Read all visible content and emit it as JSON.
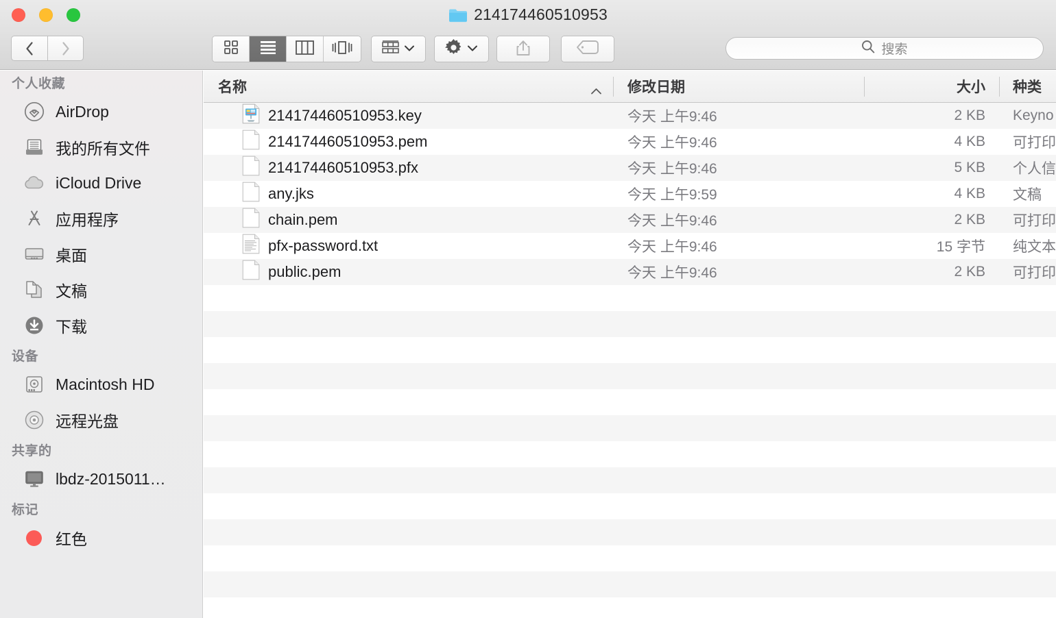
{
  "window": {
    "title": "214174460510953",
    "title_icon": "folder-icon",
    "traffic_lights": [
      {
        "name": "close",
        "color": "#ff5f52"
      },
      {
        "name": "minimize",
        "color": "#ffbd2e"
      },
      {
        "name": "zoom",
        "color": "#28c63f"
      }
    ]
  },
  "toolbar": {
    "back": {
      "icon": "chevron-left-icon",
      "enabled": true
    },
    "forward": {
      "icon": "chevron-right-icon",
      "enabled": false
    },
    "view_modes": [
      {
        "name": "icon-view",
        "icon": "grid-icon",
        "active": false
      },
      {
        "name": "list-view",
        "icon": "list-icon",
        "active": true
      },
      {
        "name": "column-view",
        "icon": "columns-icon",
        "active": false
      },
      {
        "name": "coverflow-view",
        "icon": "coverflow-icon",
        "active": false
      }
    ],
    "arrange": {
      "icon": "arrange-icon",
      "chevron": "chevron-down-icon"
    },
    "action": {
      "icon": "gear-icon",
      "chevron": "chevron-down-icon"
    },
    "share": {
      "icon": "share-icon"
    },
    "tags": {
      "icon": "tag-icon"
    },
    "search": {
      "icon": "search-icon",
      "placeholder": "搜索",
      "value": ""
    }
  },
  "sidebar": {
    "sections": [
      {
        "header": "个人收藏",
        "items": [
          {
            "label": "AirDrop",
            "icon": "airdrop-icon"
          },
          {
            "label": "我的所有文件",
            "icon": "all-my-files-icon"
          },
          {
            "label": "iCloud Drive",
            "icon": "icloud-icon"
          },
          {
            "label": "应用程序",
            "icon": "applications-icon"
          },
          {
            "label": "桌面",
            "icon": "desktop-icon"
          },
          {
            "label": "文稿",
            "icon": "documents-icon"
          },
          {
            "label": "下载",
            "icon": "downloads-icon"
          }
        ]
      },
      {
        "header": "设备",
        "items": [
          {
            "label": "Macintosh HD",
            "icon": "harddisk-icon"
          },
          {
            "label": "远程光盘",
            "icon": "disc-icon"
          }
        ]
      },
      {
        "header": "共享的",
        "items": [
          {
            "label": "lbdz-2015011…",
            "icon": "computer-icon"
          }
        ]
      },
      {
        "header": "标记",
        "items": [
          {
            "label": "红色",
            "icon": "tag-dot-icon",
            "color": "#fc5b57"
          }
        ]
      }
    ]
  },
  "file_list": {
    "columns": [
      {
        "key": "name",
        "label": "名称",
        "sort": "ascending",
        "sort_icon": "chevron-up-icon"
      },
      {
        "key": "date",
        "label": "修改日期"
      },
      {
        "key": "size",
        "label": "大小"
      },
      {
        "key": "kind",
        "label": "种类"
      }
    ],
    "rows": [
      {
        "name": "214174460510953.key",
        "date": "今天 上午9:46",
        "size": "2 KB",
        "kind": "Keyno",
        "icon": "keynote-file-icon"
      },
      {
        "name": "214174460510953.pem",
        "date": "今天 上午9:46",
        "size": "4 KB",
        "kind": "可打印",
        "icon": "blank-document-icon"
      },
      {
        "name": "214174460510953.pfx",
        "date": "今天 上午9:46",
        "size": "5 KB",
        "kind": "个人信",
        "icon": "blank-document-icon"
      },
      {
        "name": "any.jks",
        "date": "今天 上午9:59",
        "size": "4 KB",
        "kind": "文稿",
        "icon": "blank-document-icon"
      },
      {
        "name": "chain.pem",
        "date": "今天 上午9:46",
        "size": "2 KB",
        "kind": "可打印",
        "icon": "blank-document-icon"
      },
      {
        "name": "pfx-password.txt",
        "date": "今天 上午9:46",
        "size": "15 字节",
        "kind": "纯文本",
        "icon": "text-document-icon"
      },
      {
        "name": "public.pem",
        "date": "今天 上午9:46",
        "size": "2 KB",
        "kind": "可打印",
        "icon": "blank-document-icon"
      }
    ]
  },
  "colors": {
    "folder_blue": "#6dcff6",
    "accent_gray": "#6e6e6e",
    "tag_red": "#fc5b57"
  }
}
